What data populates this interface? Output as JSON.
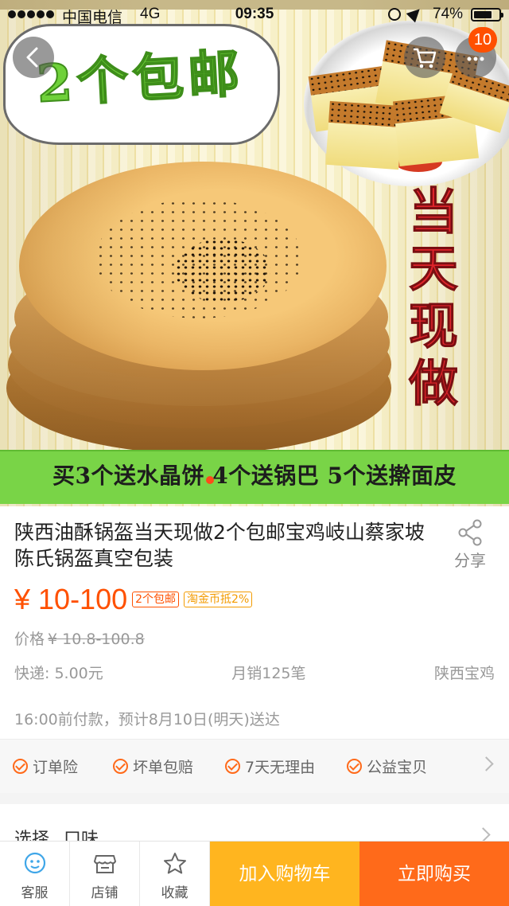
{
  "status_bar": {
    "carrier": "中国电信",
    "network": "4G",
    "time": "09:35",
    "battery": "74%"
  },
  "header": {
    "cart_badge": "10",
    "icons": [
      "back-arrow-icon",
      "cart-icon",
      "more-dots-icon"
    ]
  },
  "hero": {
    "cloud_text": "2个包邮",
    "vertical_text": [
      "当",
      "天",
      "现",
      "做"
    ],
    "promo": "买3个送水晶饼 4个送锅巴 5个送擀面皮"
  },
  "product": {
    "title": "陕西油酥锅盔当天现做2个包邮宝鸡岐山蔡家坡陈氏锅盔真空包装",
    "share_label": "分享",
    "price": "¥ 10-100",
    "tags": [
      "2个包邮",
      "淘金币抵2%"
    ],
    "orig_label": "价格",
    "orig_price": "¥ 10.8-100.8",
    "shipping": "快递: 5.00元",
    "sales": "月销125笔",
    "location": "陕西宝鸡",
    "delivery": "16:00前付款，预计8月10日(明天)送达"
  },
  "services": [
    "订单险",
    "坏单包赔",
    "7天无理由",
    "公益宝贝"
  ],
  "select": {
    "label": "选择",
    "value": "口味"
  },
  "bottom_bar": {
    "service": "客服",
    "shop": "店铺",
    "favorite": "收藏",
    "add_cart": "加入购物车",
    "buy_now": "立即购买"
  },
  "colors": {
    "accent": "#ff5000",
    "cart_button": "#ffb51f",
    "buy_button": "#ff6a1a",
    "promo_band": "#79d447"
  }
}
